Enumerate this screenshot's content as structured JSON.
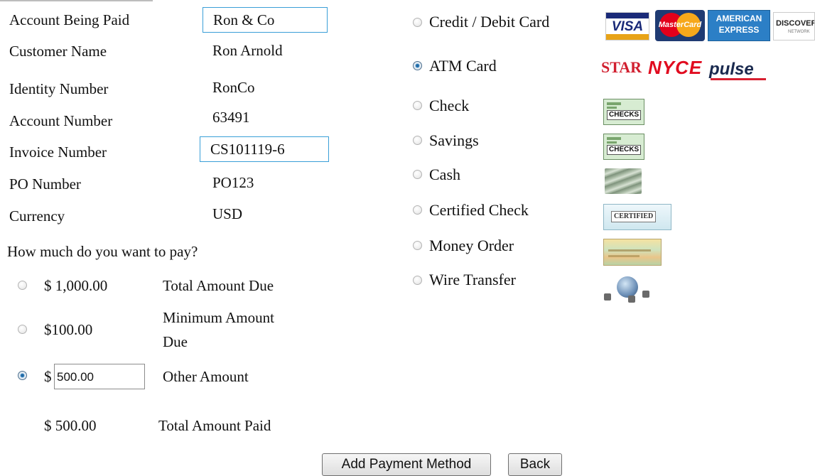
{
  "account": {
    "rows": [
      {
        "label": "Account Being Paid",
        "value": "Ron & Co"
      },
      {
        "label": "Customer Name",
        "value": "Ron Arnold"
      },
      {
        "label": "Identity Number",
        "value": "RonCo"
      },
      {
        "label": "Account Number",
        "value": "63491"
      },
      {
        "label": "Invoice Number",
        "value": "CS101119-6"
      },
      {
        "label": "PO Number",
        "value": "PO123"
      },
      {
        "label": "Currency",
        "value": "USD"
      }
    ]
  },
  "payment_amount": {
    "question": "How much do you want to pay?",
    "options": [
      {
        "amount": "$ 1,000.00",
        "description": "Total Amount Due",
        "selected": false
      },
      {
        "amount": "$100.00",
        "description_line1": "Minimum Amount",
        "description_line2": "Due",
        "selected": false
      },
      {
        "currency_symbol": "$",
        "amount_input": "500.00",
        "description": "Other Amount",
        "selected": true
      }
    ],
    "total_paid": {
      "amount": "$ 500.00",
      "label": "Total Amount Paid"
    }
  },
  "payment_methods": [
    {
      "label": "Credit / Debit Card",
      "selected": false,
      "logos": [
        "VISA",
        "MasterCard",
        "AMERICAN EXPRESS",
        "DISCOVER"
      ]
    },
    {
      "label": "ATM Card",
      "selected": true,
      "logos": [
        "STAR",
        "NYCE",
        "pulse"
      ]
    },
    {
      "label": "Check",
      "selected": false,
      "logos": [
        "CHECKS"
      ]
    },
    {
      "label": "Savings",
      "selected": false,
      "logos": [
        "CHECKS"
      ]
    },
    {
      "label": "Cash",
      "selected": false,
      "logos": [
        "cash-icon"
      ]
    },
    {
      "label": "Certified Check",
      "selected": false,
      "logos": [
        "CERTIFIED"
      ]
    },
    {
      "label": "Money Order",
      "selected": false,
      "logos": [
        "money-order-icon"
      ]
    },
    {
      "label": "Wire Transfer",
      "selected": false,
      "logos": [
        "wire-transfer-icon"
      ]
    }
  ],
  "logo_text": {
    "visa": "VISA",
    "mastercard": "MasterCard",
    "amex_line1": "AMERICAN",
    "amex_line2": "EXPRESS",
    "discover": "DISCOVER",
    "discover_sub": "NETWORK",
    "star": "STAR",
    "nyce": "NYCE",
    "pulse": "pulse",
    "checks": "CHECKS",
    "certified": "CERTIFIED"
  },
  "buttons": {
    "add_payment_method": "Add Payment Method",
    "back": "Back"
  },
  "colors": {
    "input_border_focus": "#3a9fd8",
    "radio_selected": "#2f7fbf"
  }
}
